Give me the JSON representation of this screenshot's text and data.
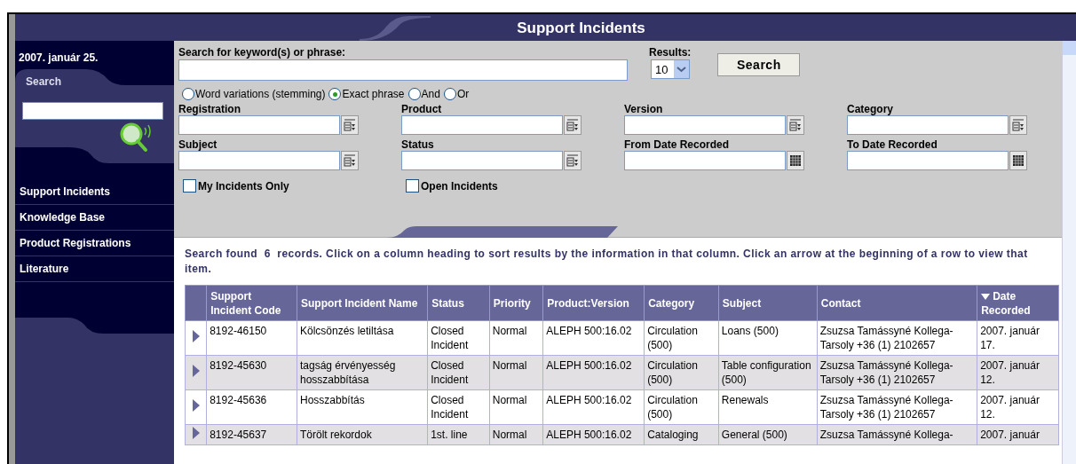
{
  "header": {
    "title": "Support Incidents"
  },
  "sidebar": {
    "date": "2007. január 25.",
    "search_tab": "Search",
    "nav": [
      "Support Incidents",
      "Knowledge Base",
      "Product Registrations",
      "Literature"
    ]
  },
  "search": {
    "label": "Search for keyword(s) or phrase:",
    "results_label": "Results:",
    "results_value": "10",
    "button": "Search",
    "modes": [
      {
        "label": "Word variations (stemming)",
        "selected": false
      },
      {
        "label": "Exact phrase",
        "selected": true
      },
      {
        "label": "And",
        "selected": false
      },
      {
        "label": "Or",
        "selected": false
      }
    ],
    "fields": [
      {
        "label": "Registration",
        "kind": "lookup"
      },
      {
        "label": "Product",
        "kind": "lookup"
      },
      {
        "label": "Version",
        "kind": "lookup"
      },
      {
        "label": "Category",
        "kind": "lookup"
      },
      {
        "label": "Subject",
        "kind": "lookup"
      },
      {
        "label": "Status",
        "kind": "lookup"
      },
      {
        "label": "From Date Recorded",
        "kind": "date"
      },
      {
        "label": "To Date Recorded",
        "kind": "date"
      }
    ],
    "checkboxes": [
      {
        "label": "My Incidents Only",
        "checked": false
      },
      {
        "label": "Open Incidents",
        "checked": false
      }
    ]
  },
  "summary": {
    "prefix": "Search found",
    "count": "6",
    "text": "records. Click on a column heading to sort results by the information in that column. Click an arrow at the beginning of a row to view that item."
  },
  "table": {
    "columns": [
      {
        "label": "Support Incident Code",
        "sorted": false
      },
      {
        "label": "Support Incident Name",
        "sorted": false
      },
      {
        "label": "Status",
        "sorted": false
      },
      {
        "label": "Priority",
        "sorted": false
      },
      {
        "label": "Product:Version",
        "sorted": false
      },
      {
        "label": "Category",
        "sorted": false
      },
      {
        "label": "Subject",
        "sorted": false
      },
      {
        "label": "Contact",
        "sorted": false
      },
      {
        "label": "Date Recorded",
        "sorted": true
      }
    ],
    "rows": [
      [
        "8192-46150",
        "Kölcsönzés letiltása",
        "Closed Incident",
        "Normal",
        "ALEPH 500:16.02",
        "Circulation (500)",
        "Loans (500)",
        "Zsuzsa Tamássyné Kollega-Tarsoly +36 (1) 2102657",
        "2007. január 17."
      ],
      [
        "8192-45630",
        "tagság érvényesség hosszabbítása",
        "Closed Incident",
        "Normal",
        "ALEPH 500:16.02",
        "Circulation (500)",
        "Table configuration (500)",
        "Zsuzsa Tamássyné Kollega-Tarsoly +36 (1) 2102657",
        "2007. január 12."
      ],
      [
        "8192-45636",
        "Hosszabbítás",
        "Closed Incident",
        "Normal",
        "ALEPH 500:16.02",
        "Circulation (500)",
        "Renewals",
        "Zsuzsa Tamássyné Kollega-Tarsoly +36 (1) 2102657",
        "2007. január 12."
      ],
      [
        "8192-45637",
        "Törölt rekordok",
        "1st. line",
        "Normal",
        "ALEPH 500:16.02",
        "Cataloging",
        "General (500)",
        "Zsuzsa Tamássyné Kollega-",
        "2007. január"
      ]
    ]
  }
}
